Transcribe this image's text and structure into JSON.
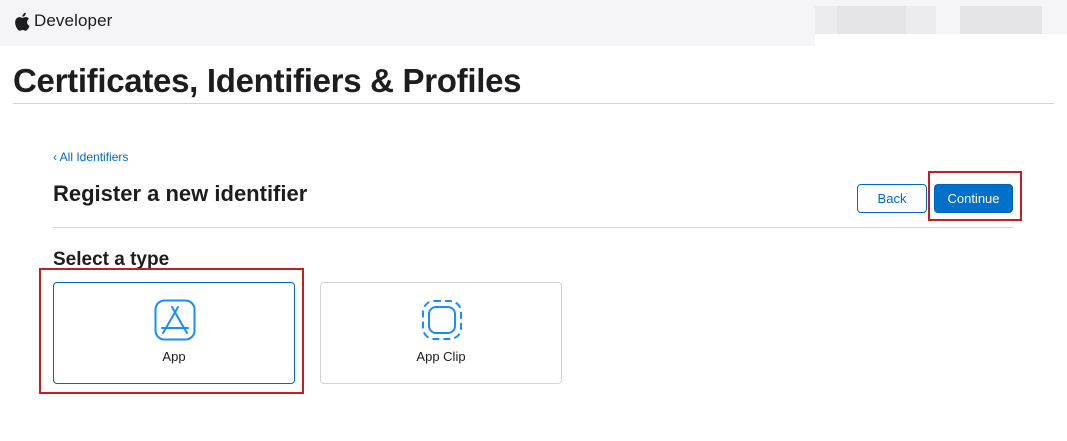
{
  "header": {
    "brand_label": "Developer",
    "icons": {
      "brand": "apple-logo-icon"
    }
  },
  "page": {
    "title": "Certificates, Identifiers & Profiles"
  },
  "main": {
    "back_link": "‹ All Identifiers",
    "heading": "Register a new identifier",
    "buttons": {
      "back": "Back",
      "continue": "Continue"
    },
    "select_heading": "Select a type",
    "types": [
      {
        "label": "App",
        "icon": "app-store-icon",
        "selected": true
      },
      {
        "label": "App Clip",
        "icon": "app-clip-icon",
        "selected": false
      }
    ]
  },
  "colors": {
    "accent": "#0070c9",
    "link": "#0066cc",
    "highlight": "#c41e20",
    "topbar": "#f5f5f7",
    "text": "#1d1d1f"
  }
}
